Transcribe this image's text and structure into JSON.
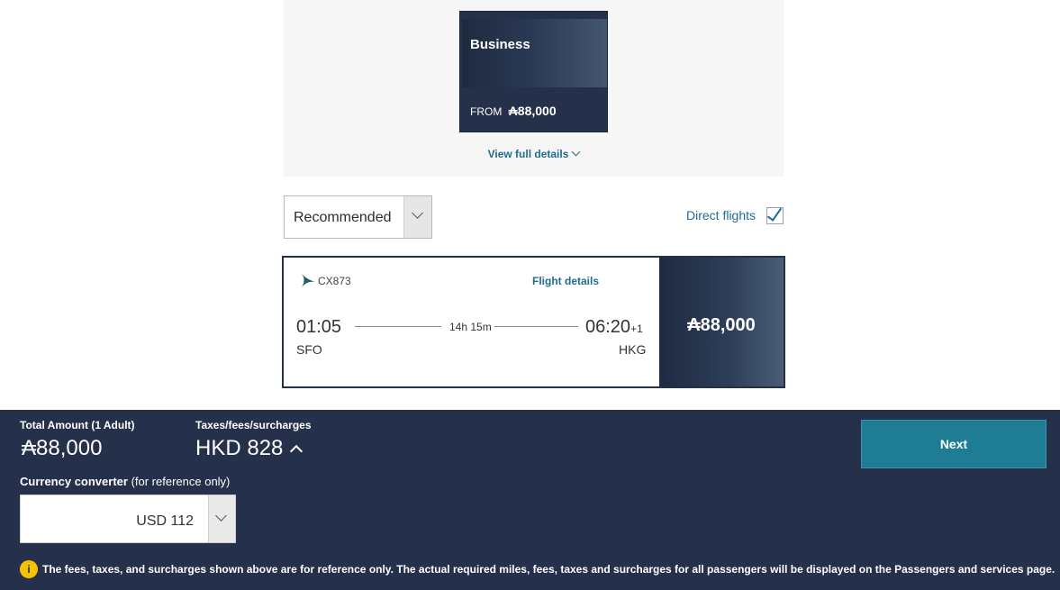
{
  "cabin_card": {
    "name": "Business",
    "from_label": "FROM",
    "price": "₳88,000"
  },
  "view_full_details": "View full details",
  "sort": {
    "selected": "Recommended"
  },
  "filter": {
    "direct_flights_label": "Direct flights",
    "direct_flights_checked": true
  },
  "flight": {
    "number": "CX873",
    "details_link": "Flight details",
    "departure_time": "01:05",
    "departure_code": "SFO",
    "duration": "14h 15m",
    "arrival_time": "06:20",
    "arrival_offset": "+1",
    "arrival_code": "HKG",
    "price": "₳88,000"
  },
  "footer": {
    "total_label": "Total Amount (1 Adult)",
    "total_value": "₳88,000",
    "taxes_label": "Taxes/fees/surcharges",
    "taxes_value": "HKD 828",
    "converter_label": "Currency converter",
    "converter_note": " (for reference only)",
    "converter_value": "USD 112",
    "next_label": "Next",
    "disclaimer": "The fees, taxes, and surcharges shown above are for reference only. The actual required miles, fees, taxes and surcharges for all passengers will be displayed on the Passengers and services page."
  },
  "colors": {
    "navy": "#25314a",
    "link_teal": "#1f6d8c",
    "button_teal": "#1e7d94",
    "info_yellow": "#f4c400"
  }
}
